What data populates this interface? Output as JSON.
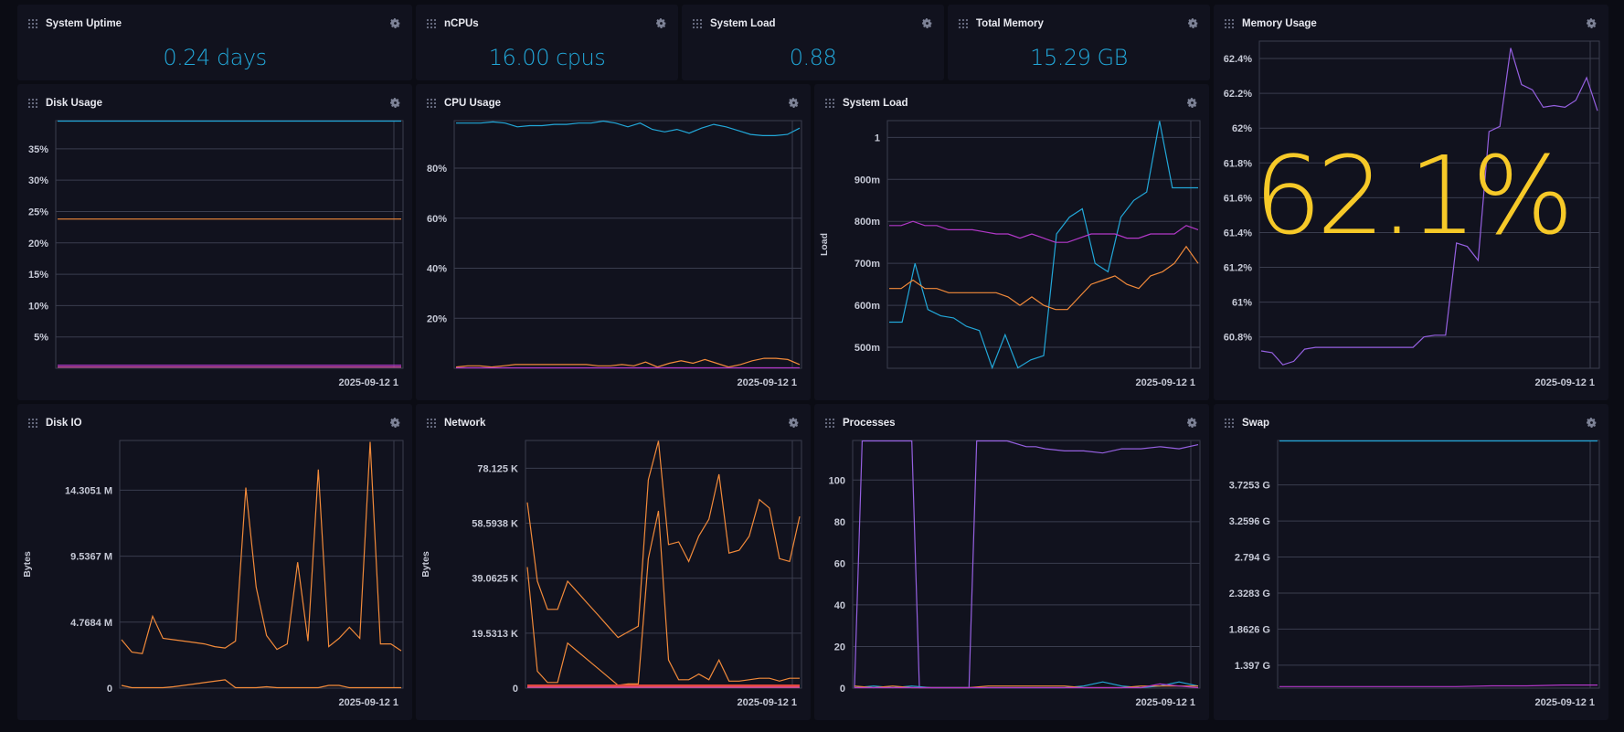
{
  "colors": {
    "blue": "#22a7d8",
    "orange": "#f28a3a",
    "magenta": "#b238c8",
    "purple": "#9560e0",
    "yellow": "#f6c928",
    "red": "#e0483e",
    "pink": "#e050b0"
  },
  "icons": {
    "drag": "drag-handle-icon",
    "settings": "gear-icon"
  },
  "stats": [
    {
      "title": "System Uptime",
      "value": "0.24 days"
    },
    {
      "title": "nCPUs",
      "value": "16.00 cpus"
    },
    {
      "title": "System Load",
      "value": "0.88"
    },
    {
      "title": "Total Memory",
      "value": "15.29 GB"
    }
  ],
  "memory_big": "62.1%",
  "chart_data": [
    {
      "id": "disk_usage",
      "type": "line",
      "title": "Disk Usage",
      "ylabel": "",
      "xtick": "2025-09-12 1",
      "ylim": [
        0,
        39.5
      ],
      "yticks": [
        {
          "v": 5,
          "t": "5%"
        },
        {
          "v": 10,
          "t": "10%"
        },
        {
          "v": 15,
          "t": "15%"
        },
        {
          "v": 20,
          "t": "20%"
        },
        {
          "v": 25,
          "t": "25%"
        },
        {
          "v": 30,
          "t": "30%"
        },
        {
          "v": 35,
          "t": "35%"
        }
      ],
      "series": [
        {
          "color": "#22a7d8",
          "values": [
            39.5,
            39.5,
            39.5,
            39.5,
            39.5,
            39.5,
            39.5,
            39.5,
            39.5,
            39.5,
            39.5
          ]
        },
        {
          "color": "#f28a3a",
          "values": [
            23.8,
            23.8,
            23.8,
            23.8,
            23.8,
            23.8,
            23.8,
            23.8,
            23.8,
            23.8,
            23.8
          ]
        },
        {
          "color": "#b238c8",
          "values": [
            0.5,
            0.5,
            0.5,
            0.5,
            0.5,
            0.5,
            0.5,
            0.5,
            0.5,
            0.5,
            0.5
          ]
        },
        {
          "color": "#e050b0",
          "values": [
            0.2,
            0.2,
            0.2,
            0.2,
            0.2,
            0.2,
            0.2,
            0.2,
            0.2,
            0.2,
            0.2
          ]
        }
      ]
    },
    {
      "id": "cpu_usage",
      "type": "line",
      "title": "CPU Usage",
      "ylabel": "",
      "xtick": "2025-09-12 1",
      "ylim": [
        0,
        99
      ],
      "yticks": [
        {
          "v": 20,
          "t": "20%"
        },
        {
          "v": 40,
          "t": "40%"
        },
        {
          "v": 60,
          "t": "60%"
        },
        {
          "v": 80,
          "t": "80%"
        }
      ],
      "series": [
        {
          "color": "#22a7d8",
          "values": [
            98,
            98,
            98,
            98.5,
            98,
            96.5,
            97,
            97,
            97.5,
            97.5,
            98,
            98,
            99,
            98,
            96.5,
            98,
            95.5,
            94.5,
            95.5,
            94,
            96,
            97.5,
            96.5,
            95,
            93.5,
            93,
            93,
            93.5,
            96
          ]
        },
        {
          "color": "#f28a3a",
          "values": [
            0.5,
            1,
            1,
            0.5,
            1,
            1.5,
            1.5,
            1.5,
            1.5,
            1.5,
            1.5,
            1.5,
            1,
            1,
            1.5,
            1,
            2.5,
            0.5,
            2,
            3,
            2,
            3.5,
            2,
            0.5,
            1.5,
            3,
            4,
            4,
            3.5,
            1.5
          ]
        },
        {
          "color": "#b238c8",
          "values": [
            0.2,
            0.2,
            0.2,
            0.2,
            0.2,
            0.2,
            0.2,
            0.2,
            0.2,
            0.2,
            0.2,
            0.2,
            0.2,
            0.2,
            0.2,
            0.2,
            0.2,
            0.2,
            0.2,
            0.2,
            0.2,
            0.2,
            0.2,
            0.2,
            0.2,
            0.2,
            0.2,
            0.2,
            0.2,
            0.2
          ]
        }
      ]
    },
    {
      "id": "system_load",
      "type": "line",
      "title": "System Load",
      "ylabel": "Load",
      "xtick": "2025-09-12 1",
      "ylim": [
        0.45,
        1.04
      ],
      "yticks": [
        {
          "v": 0.5,
          "t": "500m"
        },
        {
          "v": 0.6,
          "t": "600m"
        },
        {
          "v": 0.7,
          "t": "700m"
        },
        {
          "v": 0.8,
          "t": "800m"
        },
        {
          "v": 0.9,
          "t": "900m"
        },
        {
          "v": 1.0,
          "t": "1"
        }
      ],
      "series": [
        {
          "color": "#22a7d8",
          "x": [
            0,
            1,
            2,
            3,
            4,
            5,
            6,
            7,
            8,
            9,
            10,
            11,
            12,
            13,
            14,
            15,
            16,
            17,
            18,
            19,
            20,
            21,
            22,
            23,
            24
          ],
          "values": [
            0.56,
            0.56,
            0.7,
            0.59,
            0.575,
            0.57,
            0.55,
            0.54,
            0.45,
            0.53,
            0.45,
            0.47,
            0.48,
            0.77,
            0.81,
            0.83,
            0.7,
            0.68,
            0.81,
            0.85,
            0.87,
            1.04,
            0.88,
            0.88,
            0.88
          ]
        },
        {
          "color": "#f28a3a",
          "values": [
            0.64,
            0.64,
            0.66,
            0.64,
            0.64,
            0.63,
            0.63,
            0.63,
            0.63,
            0.63,
            0.62,
            0.6,
            0.62,
            0.6,
            0.59,
            0.59,
            0.62,
            0.65,
            0.66,
            0.67,
            0.65,
            0.64,
            0.67,
            0.68,
            0.7,
            0.74,
            0.7
          ]
        },
        {
          "color": "#b238c8",
          "values": [
            0.79,
            0.79,
            0.8,
            0.79,
            0.79,
            0.78,
            0.78,
            0.78,
            0.775,
            0.77,
            0.77,
            0.76,
            0.77,
            0.76,
            0.75,
            0.75,
            0.76,
            0.77,
            0.77,
            0.77,
            0.76,
            0.76,
            0.77,
            0.77,
            0.77,
            0.79,
            0.78
          ]
        }
      ]
    },
    {
      "id": "memory_usage",
      "type": "line",
      "title": "Memory Usage",
      "ylabel": "",
      "xtick": "2025-09-12 1",
      "ylim": [
        60.62,
        62.5
      ],
      "yticks": [
        {
          "v": 60.8,
          "t": "60.8%"
        },
        {
          "v": 61,
          "t": "61%"
        },
        {
          "v": 61.2,
          "t": "61.2%"
        },
        {
          "v": 61.4,
          "t": "61.4%"
        },
        {
          "v": 61.6,
          "t": "61.6%"
        },
        {
          "v": 61.8,
          "t": "61.8%"
        },
        {
          "v": 62,
          "t": "62%"
        },
        {
          "v": 62.2,
          "t": "62.2%"
        },
        {
          "v": 62.4,
          "t": "62.4%"
        }
      ],
      "series": [
        {
          "color": "#9560e0",
          "x": [
            0,
            1,
            2,
            3,
            4,
            5,
            6,
            7,
            8,
            9,
            10,
            11,
            12,
            13,
            14,
            15,
            16,
            17,
            18,
            19,
            20,
            21,
            22,
            23,
            24,
            25,
            26,
            27,
            28,
            29,
            30,
            31
          ],
          "values": [
            60.72,
            60.71,
            60.64,
            60.66,
            60.73,
            60.74,
            60.74,
            60.74,
            60.74,
            60.74,
            60.74,
            60.74,
            60.74,
            60.74,
            60.74,
            60.8,
            60.81,
            60.81,
            61.34,
            61.32,
            61.24,
            61.98,
            62.01,
            62.46,
            62.25,
            62.22,
            62.12,
            62.13,
            62.12,
            62.16,
            62.29,
            62.1
          ]
        }
      ]
    },
    {
      "id": "disk_io",
      "type": "line",
      "title": "Disk IO",
      "ylabel": "Bytes",
      "xtick": "2025-09-12 1",
      "ylim": [
        0,
        17.9
      ],
      "yticks": [
        {
          "v": 0,
          "t": "0"
        },
        {
          "v": 4.7684,
          "t": "4.7684 M"
        },
        {
          "v": 9.5367,
          "t": "9.5367 M"
        },
        {
          "v": 14.3051,
          "t": "14.3051 M"
        }
      ],
      "series": [
        {
          "color": "#f28a3a",
          "values": [
            3.5,
            2.6,
            2.5,
            5.2,
            3.6,
            3.5,
            3.4,
            3.3,
            3.2,
            3.0,
            2.9,
            3.4,
            14.5,
            7.3,
            3.8,
            2.8,
            3.2,
            9.1,
            3.4,
            15.8,
            3.0,
            3.6,
            4.4,
            3.6,
            17.8,
            3.2,
            3.2,
            2.7
          ]
        },
        {
          "color": "#f28a3a",
          "values": [
            0.2,
            0,
            0,
            0,
            0,
            0.1,
            0.2,
            0.3,
            0.4,
            0.5,
            0.6,
            0,
            0,
            0,
            0.1,
            0,
            0,
            0,
            0,
            0,
            0.2,
            0.2,
            0,
            0,
            0,
            0,
            0,
            0
          ]
        }
      ]
    },
    {
      "id": "network",
      "type": "line",
      "title": "Network",
      "ylabel": "Bytes",
      "xtick": "2025-09-12 1",
      "ylim": [
        0,
        88
      ],
      "yticks": [
        {
          "v": 0,
          "t": "0"
        },
        {
          "v": 19.5313,
          "t": "19.5313 K"
        },
        {
          "v": 39.0625,
          "t": "39.0625 K"
        },
        {
          "v": 58.5938,
          "t": "58.5938 K"
        },
        {
          "v": 78.125,
          "t": "78.125 K"
        }
      ],
      "series": [
        {
          "color": "#f28a3a",
          "values": [
            66,
            38,
            28,
            28,
            38,
            34,
            30,
            26,
            22,
            18,
            20,
            22,
            74,
            88,
            51,
            52,
            45,
            54,
            60,
            76,
            48,
            49,
            54,
            67,
            64,
            46,
            45,
            61
          ]
        },
        {
          "color": "#f28a3a",
          "values": [
            43,
            6,
            2,
            2,
            16,
            13,
            10,
            7,
            4,
            1,
            1.5,
            1.5,
            46,
            63,
            10,
            3,
            3,
            5,
            3,
            10,
            2.5,
            2.5,
            3,
            3.5,
            3.5,
            2.5,
            3.5,
            3.5
          ]
        },
        {
          "color": "#e0483e",
          "values": [
            0.8,
            0.8,
            0.8,
            0.8,
            0.8,
            0.8,
            0.8,
            0.8,
            0.8,
            0.8,
            0.8,
            0.8,
            0.8,
            0.8,
            0.8,
            0.8,
            0.8,
            0.8,
            0.8,
            0.8,
            0.8,
            0.8,
            0.8,
            0.8,
            0.8,
            0.8,
            0.8,
            0.8
          ]
        },
        {
          "color": "#e050b0",
          "values": [
            0.3,
            0.3,
            0.3,
            0.3,
            0.3,
            0.3,
            0.3,
            0.3,
            0.3,
            0.3,
            0.3,
            0.3,
            0.3,
            0.3,
            0.3,
            0.3,
            0.3,
            0.3,
            0.3,
            0.3,
            0.3,
            0.3,
            0.3,
            0.3,
            0.3,
            0.3,
            0.3,
            0.3
          ]
        }
      ]
    },
    {
      "id": "processes",
      "type": "line",
      "title": "Processes",
      "ylabel": "",
      "xtick": "2025-09-12 1",
      "ylim": [
        0,
        119
      ],
      "yticks": [
        {
          "v": 0,
          "t": "0"
        },
        {
          "v": 20,
          "t": "20"
        },
        {
          "v": 40,
          "t": "40"
        },
        {
          "v": 60,
          "t": "60"
        },
        {
          "v": 80,
          "t": "80"
        },
        {
          "v": 100,
          "t": "100"
        }
      ],
      "series": [
        {
          "color": "#9560e0",
          "x": [
            0,
            0.4,
            3,
            3.4,
            6,
            6.4,
            8,
            9,
            9.5,
            10,
            11,
            12,
            13,
            14,
            15,
            16,
            17,
            18
          ],
          "values": [
            0,
            119,
            119,
            0,
            0,
            119,
            119,
            116,
            116,
            115,
            114,
            114,
            113,
            115,
            115,
            116,
            115,
            117
          ]
        },
        {
          "color": "#22a7d8",
          "x": [
            0,
            1,
            2,
            3,
            4,
            5,
            6,
            7,
            8,
            9,
            10,
            11,
            12,
            13,
            14,
            15,
            16,
            17,
            18
          ],
          "values": [
            0,
            1,
            0,
            1,
            0,
            0,
            0,
            0,
            0,
            0,
            0,
            0,
            1,
            3,
            1,
            0,
            1,
            3,
            1
          ]
        },
        {
          "color": "#f28a3a",
          "x": [
            0,
            1,
            2,
            3,
            4,
            5,
            6,
            7,
            8,
            9,
            10,
            11,
            12,
            13,
            14,
            15,
            16,
            17,
            18
          ],
          "values": [
            1,
            0,
            1,
            0,
            0,
            0,
            0,
            1,
            1,
            1,
            1,
            1,
            0,
            0,
            0,
            1,
            1,
            1,
            1
          ]
        },
        {
          "color": "#b238c8",
          "x": [
            0,
            1,
            2,
            3,
            4,
            5,
            6,
            7,
            8,
            9,
            10,
            11,
            12,
            13,
            14,
            15,
            16,
            17,
            18
          ],
          "values": [
            0,
            0,
            0,
            0,
            0,
            0,
            0,
            0,
            0,
            0,
            0,
            0,
            0,
            0,
            0,
            0,
            2,
            1,
            0
          ]
        }
      ]
    },
    {
      "id": "swap",
      "type": "line",
      "title": "Swap",
      "ylabel": "",
      "xtick": "2025-09-12 1",
      "ylim": [
        1.1,
        4.3
      ],
      "yticks": [
        {
          "v": 1.397,
          "t": "1.397 G"
        },
        {
          "v": 1.8626,
          "t": "1.8626 G"
        },
        {
          "v": 2.3283,
          "t": "2.3283 G"
        },
        {
          "v": 2.794,
          "t": "2.794 G"
        },
        {
          "v": 3.2596,
          "t": "3.2596 G"
        },
        {
          "v": 3.7253,
          "t": "3.7253 G"
        }
      ],
      "series": [
        {
          "color": "#22a7d8",
          "values": [
            4.3,
            4.3,
            4.3,
            4.3,
            4.3,
            4.3,
            4.3,
            4.3,
            4.3,
            4.3
          ]
        },
        {
          "color": "#b238c8",
          "values": [
            1.12,
            1.12,
            1.12,
            1.12,
            1.12,
            1.12,
            1.13,
            1.13,
            1.14,
            1.14
          ]
        }
      ]
    }
  ]
}
